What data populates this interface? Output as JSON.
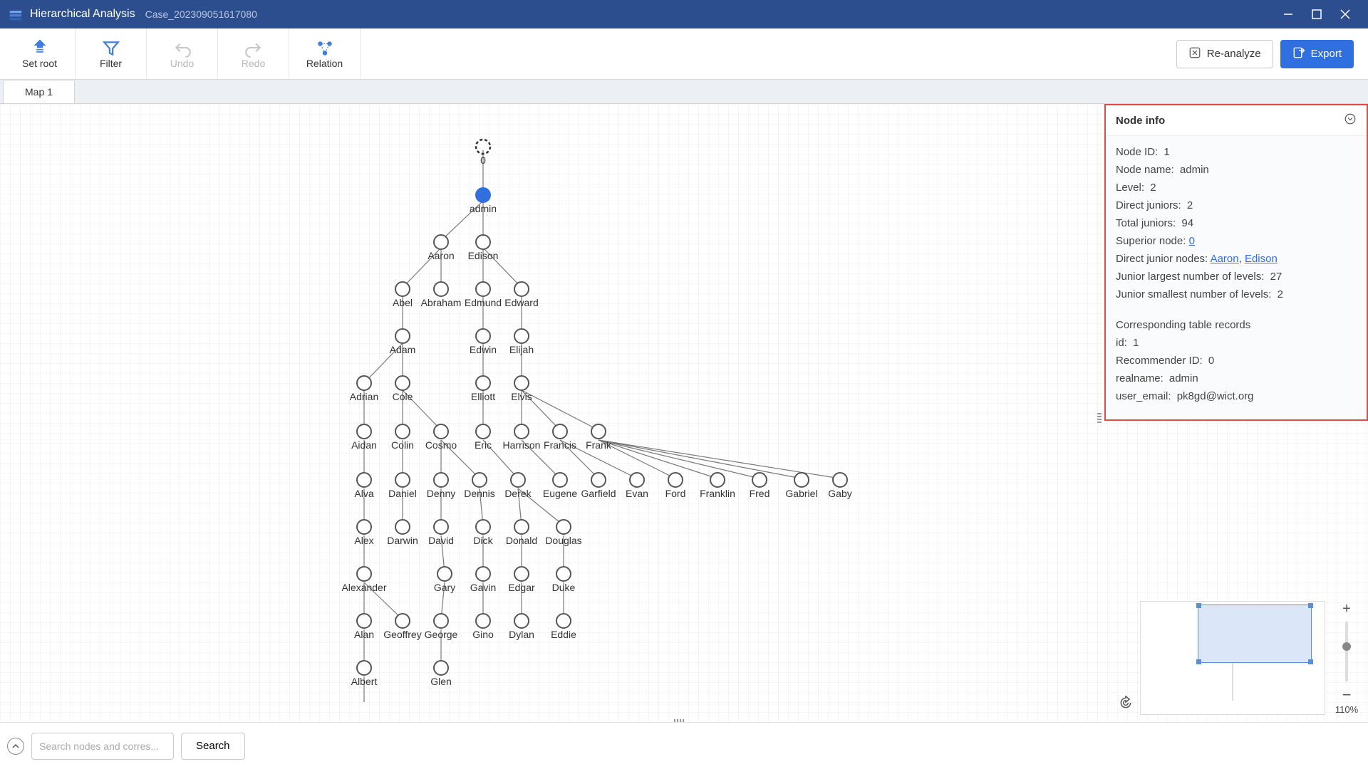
{
  "titlebar": {
    "app": "Hierarchical Analysis",
    "case": "Case_202309051617080"
  },
  "toolbar": {
    "set_root": "Set root",
    "filter": "Filter",
    "undo": "Undo",
    "redo": "Redo",
    "relation": "Relation",
    "reanalyze": "Re-analyze",
    "export": "Export"
  },
  "tabs": {
    "map1": "Map 1"
  },
  "panel": {
    "title": "Node info",
    "node_id_label": "Node ID:",
    "node_id": "1",
    "node_name_label": "Node name:",
    "node_name": "admin",
    "level_label": "Level:",
    "level": "2",
    "direct_juniors_label": "Direct juniors:",
    "direct_juniors": "2",
    "total_juniors_label": "Total juniors:",
    "total_juniors": "94",
    "superior_label": "Superior node:",
    "superior": "0",
    "direct_junior_nodes_label": "Direct junior nodes:",
    "dj1": "Aaron",
    "dj2": "Edison",
    "largest_label": "Junior largest number of levels:",
    "largest": "27",
    "smallest_label": "Junior smallest number of levels:",
    "smallest": "2",
    "records_title": "Corresponding table records",
    "id_label": "id:",
    "id_val": "1",
    "rec_label": "Recommender ID:",
    "rec_val": "0",
    "realname_label": "realname:",
    "realname_val": "admin",
    "email_label": "user_email:",
    "email_val": "pk8gd@wict.org"
  },
  "zoom": {
    "value": "110%"
  },
  "footer": {
    "search_placeholder": "Search nodes and corres...",
    "search_btn": "Search"
  },
  "graph": {
    "root_label": "0",
    "nodes": {
      "admin": "admin",
      "aaron": "Aaron",
      "edison": "Edison",
      "abel": "Abel",
      "abraham": "Abraham",
      "edmund": "Edmund",
      "edward": "Edward",
      "adam": "Adam",
      "edwin": "Edwin",
      "elijah": "Elijah",
      "adrian": "Adrian",
      "cole": "Cole",
      "elliott": "Elliott",
      "elvis": "Elvis",
      "aidan": "Aidan",
      "colin": "Colin",
      "cosmo": "Cosmo",
      "eric": "Eric",
      "harrison": "Harrison",
      "francis": "Francis",
      "frank": "Frank",
      "alva": "Alva",
      "daniel": "Daniel",
      "denny": "Denny",
      "dennis": "Dennis",
      "derek": "Derek",
      "eugene": "Eugene",
      "garfield": "Garfield",
      "evan": "Evan",
      "ford": "Ford",
      "franklin": "Franklin",
      "fred": "Fred",
      "gabriel": "Gabriel",
      "gaby": "Gaby",
      "alex": "Alex",
      "darwin": "Darwin",
      "david": "David",
      "dick": "Dick",
      "donald": "Donald",
      "douglas": "Douglas",
      "alexander": "Alexander",
      "gary": "Gary",
      "gavin": "Gavin",
      "edgar": "Edgar",
      "duke": "Duke",
      "alan": "Alan",
      "geoffrey": "Geoffrey",
      "george": "George",
      "gino": "Gino",
      "dylan": "Dylan",
      "eddie": "Eddie",
      "albert": "Albert",
      "glen": "Glen"
    }
  }
}
